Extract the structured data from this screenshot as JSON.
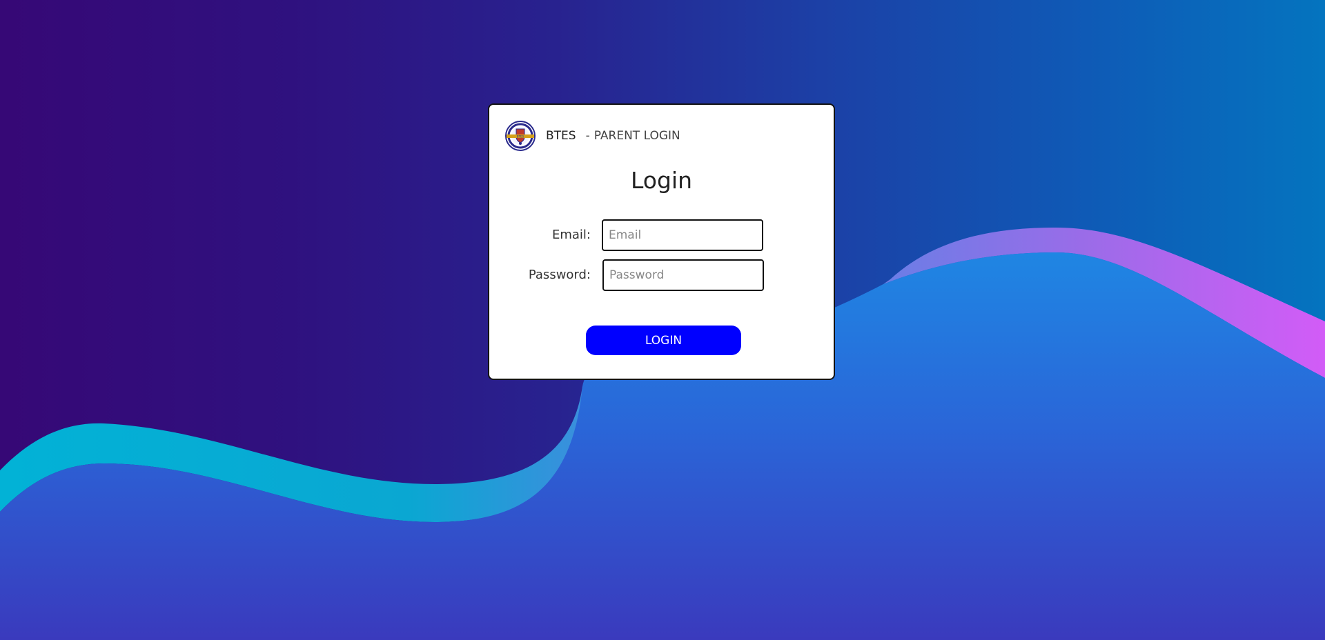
{
  "header": {
    "school_name": "BTES",
    "separator": "-",
    "portal_label": "PARENT LOGIN",
    "logo_icon": "school-crest-logo"
  },
  "form": {
    "title": "Login",
    "email_label": "Email:",
    "email_placeholder": "Email",
    "email_value": "",
    "password_label": "Password:",
    "password_placeholder": "Password",
    "password_value": "",
    "submit_label": "LOGIN"
  },
  "colors": {
    "button": "#0000ff",
    "background_start": "#360876",
    "background_end": "#0474bf",
    "wave_cyan": "#03a8cf",
    "wave_magenta": "#cc5cf5",
    "wave_fill": "#1f86e3"
  }
}
